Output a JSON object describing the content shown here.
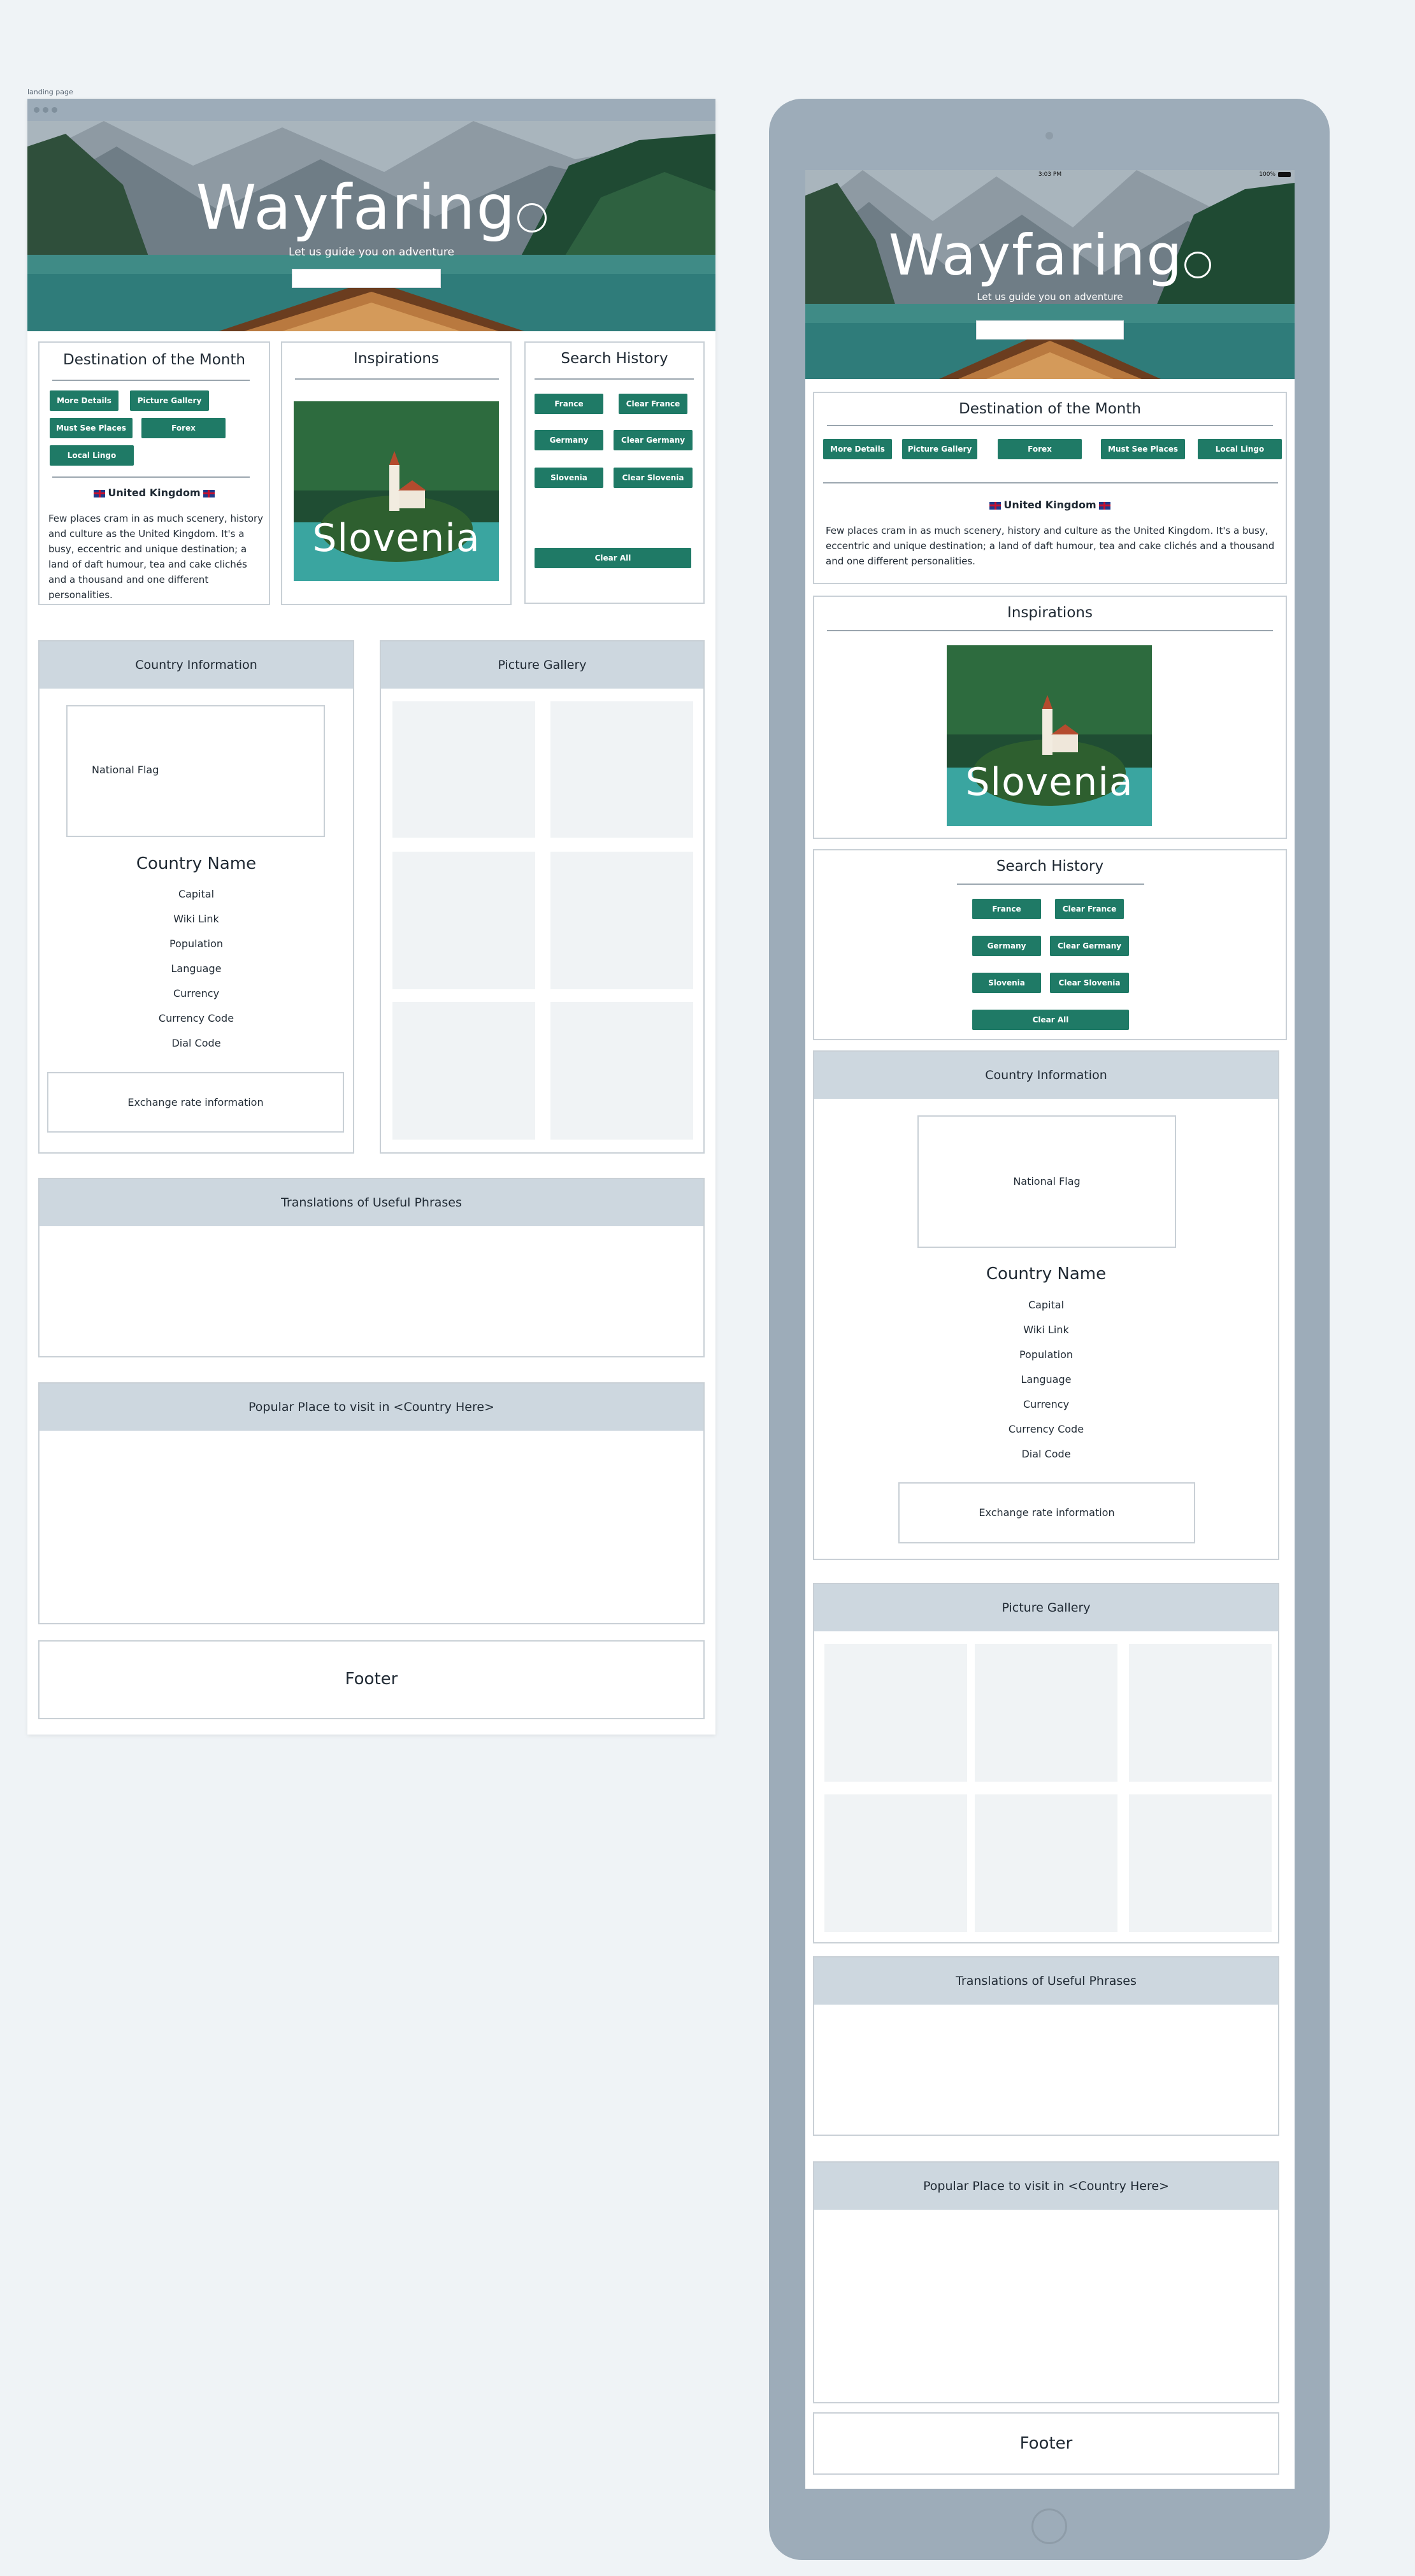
{
  "canvas": {
    "label": "landing page"
  },
  "hero": {
    "title": "Wayfaring",
    "subtitle": "Let us guide you on adventure",
    "search_placeholder": ""
  },
  "destination": {
    "title": "Destination of the Month",
    "buttons": [
      "More Details",
      "Picture Gallery",
      "Must See Places",
      "Forex",
      "Local Lingo"
    ],
    "country": "United Kingdom",
    "description": "Few places cram in as much scenery, history and culture as the United Kingdom. It's a busy, eccentric and unique destination; a land of daft humour, tea and cake clichés and a thousand and one different personalities."
  },
  "inspirations": {
    "title": "Inspirations",
    "image_caption": "Slovenia"
  },
  "search_history": {
    "title": "Search History",
    "items": [
      {
        "country": "France",
        "clear": "Clear France"
      },
      {
        "country": "Germany",
        "clear": "Clear Germany"
      },
      {
        "country": "Slovenia",
        "clear": "Clear Slovenia"
      }
    ],
    "clear_all": "Clear All"
  },
  "country_info": {
    "title": "Country Information",
    "flag_label": "National Flag",
    "name": "Country Name",
    "fields": [
      "Capital",
      "Wiki Link",
      "Population",
      "Language",
      "Currency",
      "Currency Code",
      "Dial Code"
    ],
    "exchange": "Exchange rate information"
  },
  "gallery": {
    "title": "Picture Gallery"
  },
  "phrases": {
    "title": "Translations of Useful Phrases"
  },
  "popular": {
    "title": "Popular Place to visit in <Country Here>"
  },
  "footer": {
    "label": "Footer"
  },
  "tablet_status": {
    "time": "3:03 PM",
    "battery": "100%"
  },
  "colors": {
    "accent": "#1f7a66",
    "panel_header": "#cdd7df",
    "frame": "#9dacb9",
    "background": "#eff3f6"
  }
}
